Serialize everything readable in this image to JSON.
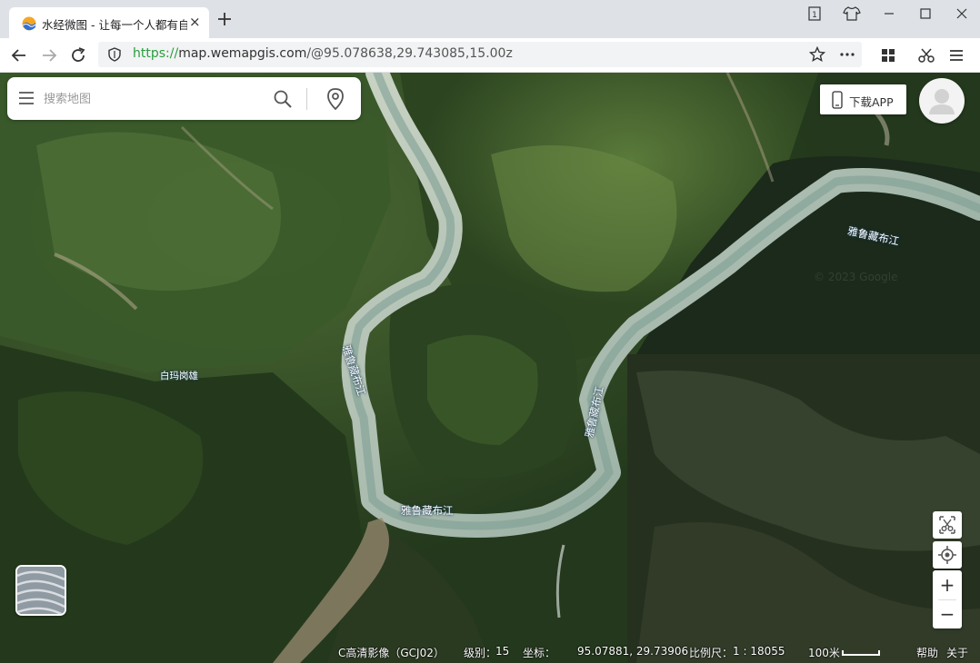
{
  "browser": {
    "tab_title": "水经微图 - 让每一个人都有自",
    "tab_close": "×",
    "new_tab": "+",
    "url_scheme": "https://",
    "url_host": "map.wemapgis.com",
    "url_rest": "/@95.078638,29.743085,15.00z",
    "window_controls": [
      "1",
      "☐",
      "—",
      "☐",
      "✕"
    ],
    "toolbar_icons": [
      "star-icon",
      "more-icon",
      "extensions-grid-icon",
      "scissors-icon",
      "hamburger-menu-icon"
    ]
  },
  "search": {
    "placeholder": "搜索地图"
  },
  "download_app": {
    "label": "下载APP"
  },
  "map": {
    "place_labels": {
      "river_top_right": "雅鲁藏布江",
      "river_left": "雅鲁藏布江",
      "river_middle": "雅鲁藏布江",
      "river_bottom": "雅鲁藏布江",
      "village": "白玛岗雄"
    },
    "watermark": "© 2023 Google"
  },
  "controls": {
    "zoom_in": "+",
    "zoom_out": "−"
  },
  "status": {
    "layer": "C高清影像（GCJ02）",
    "level_label": "级别：",
    "level_value": "15",
    "coord_label": "坐标：",
    "coord_value": "95.07881,  29.73906",
    "scale_label": "比例尺：",
    "scale_value": "1 : 18055",
    "scale_bar_text": "100米",
    "help": "帮助",
    "about": "关于"
  }
}
